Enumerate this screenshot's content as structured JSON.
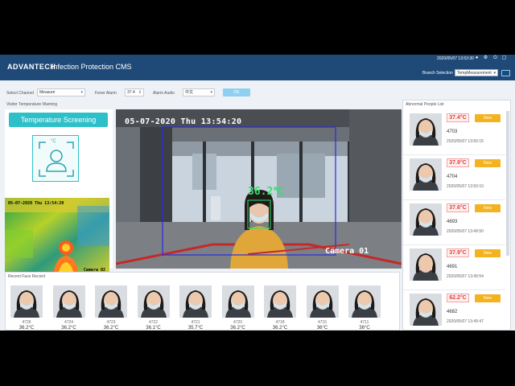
{
  "header": {
    "logo": "ADVANTECH",
    "title": "Infection Protection CMS",
    "datetime": "2020/05/07 13:53:30",
    "branch_label": "Branch Selection",
    "branch_value": "TempMeasurement"
  },
  "controls": {
    "channel_label": "Select Channel",
    "channel_value": "Measure",
    "fever_label": "Fever Alarm",
    "fever_value": "37.4",
    "audio_label": "Alarm Audio",
    "audio_value": "中文",
    "ok_label": "OK"
  },
  "visitor": {
    "panel_title": "Visitor Temperature Warning",
    "screening_title": "Temperature Screening",
    "unit": "°C",
    "thermal_stamp": "05-07-2020 Thu 13:54:20",
    "thermal_cam": "Camera 02",
    "cam_stamp": "05-07-2020 Thu 13:54:20",
    "cam_name": "Camera 01",
    "cam_temp": "36.2℃"
  },
  "recent": {
    "title": "Recent Face Record",
    "items": [
      {
        "id": "4726",
        "temp": "36.2°C"
      },
      {
        "id": "4724",
        "temp": "36.2°C"
      },
      {
        "id": "4723",
        "temp": "36.2°C"
      },
      {
        "id": "4722",
        "temp": "36.1°C"
      },
      {
        "id": "4721",
        "temp": "35.7°C"
      },
      {
        "id": "4720",
        "temp": "36.2°C"
      },
      {
        "id": "4718",
        "temp": "36.2°C"
      },
      {
        "id": "4715",
        "temp": "36°C"
      },
      {
        "id": "4711",
        "temp": "36°C"
      }
    ]
  },
  "abnormal": {
    "title": "Abnormal People List",
    "new_label": "New",
    "items": [
      {
        "temp": "37.4°C",
        "id": "4703",
        "time": "2020/05/07 13:50:15"
      },
      {
        "temp": "37.9°C",
        "id": "4704",
        "time": "2020/05/07 13:50:10"
      },
      {
        "temp": "37.6°C",
        "id": "4693",
        "time": "2020/05/07 13:49:50"
      },
      {
        "temp": "37.9°C",
        "id": "4691",
        "time": "2020/05/07 13:49:54"
      },
      {
        "temp": "62.2°C",
        "id": "4682",
        "time": "2020/05/07 13:49:47"
      }
    ]
  }
}
